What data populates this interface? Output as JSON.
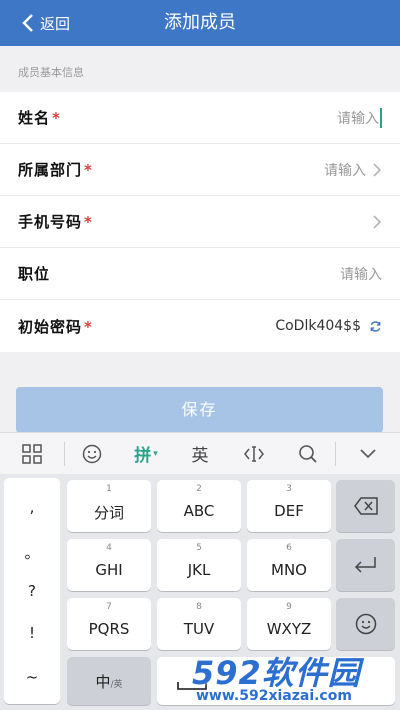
{
  "header": {
    "back_label": "返回",
    "title": "添加成员"
  },
  "section_label": "成员基本信息",
  "form": {
    "rows": [
      {
        "label": "姓名",
        "required": "*",
        "value": "请输入"
      },
      {
        "label": "所属部门",
        "required": "*",
        "value": "请输入"
      },
      {
        "label": "手机号码",
        "required": "*",
        "value": ""
      },
      {
        "label": "职位",
        "required": "",
        "value": "请输入"
      },
      {
        "label": "初始密码",
        "required": "*",
        "value": "CoDlk404$$"
      }
    ]
  },
  "save_label": "保存",
  "keyboard": {
    "toolbar": {
      "pinyin": "拼",
      "english": "英"
    },
    "punct": [
      ",",
      "。",
      "?",
      "!",
      "~"
    ],
    "keys": [
      {
        "num": "1",
        "label": "分词"
      },
      {
        "num": "2",
        "label": "ABC"
      },
      {
        "num": "3",
        "label": "DEF"
      },
      {
        "num": "4",
        "label": "GHI"
      },
      {
        "num": "5",
        "label": "JKL"
      },
      {
        "num": "6",
        "label": "MNO"
      },
      {
        "num": "7",
        "label": "PQRS"
      },
      {
        "num": "8",
        "label": "TUV"
      },
      {
        "num": "9",
        "label": "WXYZ"
      }
    ],
    "lang_key": {
      "main": "中",
      "sub": "/英"
    }
  },
  "watermark": {
    "brand": "592软件园",
    "url": "www.592xiazai.com"
  },
  "colors": {
    "header": "#3d77c5",
    "save_button": "#a7c4e6",
    "required": "#e23b3b",
    "watermark": "#2b6fd0"
  }
}
